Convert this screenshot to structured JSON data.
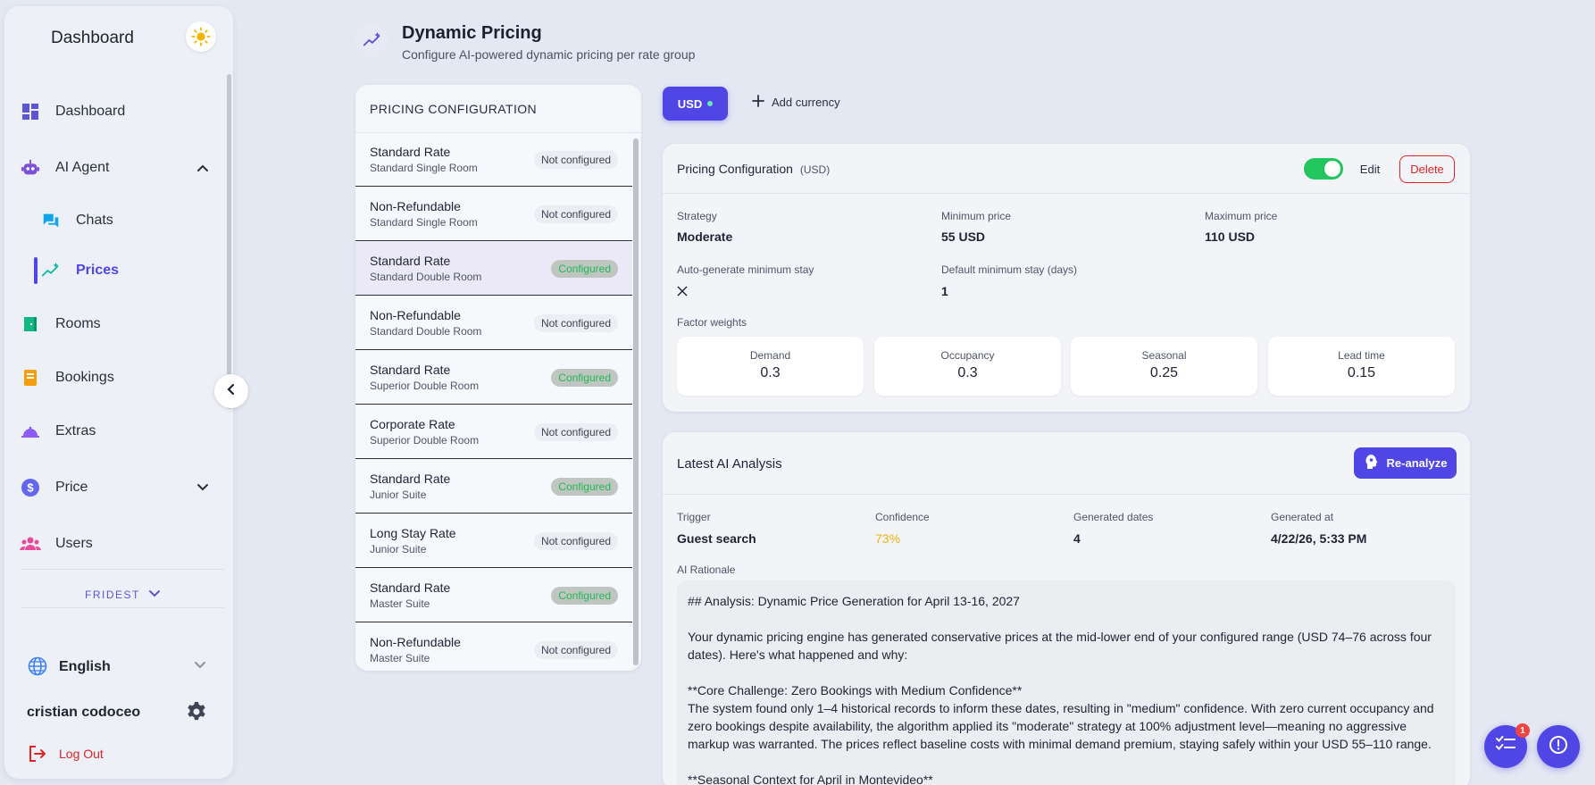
{
  "sidebar": {
    "title": "Dashboard",
    "theme_icon": "sun-icon",
    "items": [
      {
        "label": "Dashboard",
        "icon": "dashboard-grid-icon"
      },
      {
        "label": "AI Agent",
        "icon": "robot-icon"
      },
      {
        "label": "Chats",
        "icon": "chat-icon"
      },
      {
        "label": "Prices",
        "icon": "sparkle-chart-icon"
      },
      {
        "label": "Rooms",
        "icon": "door-icon"
      },
      {
        "label": "Bookings",
        "icon": "booking-icon"
      },
      {
        "label": "Extras",
        "icon": "cloche-icon"
      },
      {
        "label": "Price",
        "icon": "dollar-icon"
      },
      {
        "label": "Users",
        "icon": "users-icon"
      }
    ],
    "org": "FRIDEST",
    "language": "English",
    "user_name": "cristian codoceo",
    "logout": "Log Out"
  },
  "header": {
    "title": "Dynamic Pricing",
    "subtitle": "Configure AI-powered dynamic pricing per rate group"
  },
  "config_list": {
    "heading": "PRICING CONFIGURATION",
    "items": [
      {
        "name": "Standard Rate",
        "room": "Standard Single Room",
        "status": "Not configured"
      },
      {
        "name": "Non-Refundable",
        "room": "Standard Single Room",
        "status": "Not configured"
      },
      {
        "name": "Standard Rate",
        "room": "Standard Double Room",
        "status": "Configured"
      },
      {
        "name": "Non-Refundable",
        "room": "Standard Double Room",
        "status": "Not configured"
      },
      {
        "name": "Standard Rate",
        "room": "Superior Double Room",
        "status": "Configured"
      },
      {
        "name": "Corporate Rate",
        "room": "Superior Double Room",
        "status": "Not configured"
      },
      {
        "name": "Standard Rate",
        "room": "Junior Suite",
        "status": "Configured"
      },
      {
        "name": "Long Stay Rate",
        "room": "Junior Suite",
        "status": "Not configured"
      },
      {
        "name": "Standard Rate",
        "room": "Master Suite",
        "status": "Configured"
      },
      {
        "name": "Non-Refundable",
        "room": "Master Suite",
        "status": "Not configured"
      }
    ]
  },
  "currency": {
    "active": "USD",
    "add_label": "Add currency"
  },
  "pricing_card": {
    "title": "Pricing Configuration",
    "currency_tag": "(USD)",
    "enabled": true,
    "edit_label": "Edit",
    "delete_label": "Delete",
    "strategy_label": "Strategy",
    "strategy": "Moderate",
    "min_label": "Minimum price",
    "min": "55 USD",
    "max_label": "Maximum price",
    "max": "110 USD",
    "auto_label": "Auto-generate minimum stay",
    "auto_value_icon": "x-icon",
    "default_stay_label": "Default minimum stay (days)",
    "default_stay": "1",
    "weights_label": "Factor weights",
    "weights": [
      {
        "label": "Demand",
        "value": "0.3"
      },
      {
        "label": "Occupancy",
        "value": "0.3"
      },
      {
        "label": "Seasonal",
        "value": "0.25"
      },
      {
        "label": "Lead time",
        "value": "0.15"
      }
    ]
  },
  "analysis": {
    "title": "Latest AI Analysis",
    "reanalyze_label": "Re-analyze",
    "trigger_label": "Trigger",
    "trigger": "Guest search",
    "confidence_label": "Confidence",
    "confidence": "73%",
    "generated_dates_label": "Generated dates",
    "generated_dates": "4",
    "generated_at_label": "Generated at",
    "generated_at": "4/22/26, 5:33 PM",
    "rationale_label": "AI Rationale",
    "rationale": "## Analysis: Dynamic Price Generation for April 13-16, 2027\n\nYour dynamic pricing engine has generated conservative prices at the mid-lower end of your configured range (USD 74–76 across four dates). Here's what happened and why:\n\n**Core Challenge: Zero Bookings with Medium Confidence**\nThe system found only 1–4 historical records to inform these dates, resulting in \"medium\" confidence. With zero current occupancy and zero bookings despite availability, the algorithm applied its \"moderate\" strategy at 100% adjustment level—meaning no aggressive markup was warranted. The prices reflect baseline costs with minimal demand premium, staying safely within your USD 55–110 range.\n\n**Seasonal Context for April in Montevideo**"
  },
  "fab": {
    "tasks_badge": "1"
  },
  "colors": {
    "accent": "#4f46e5",
    "success": "#22c55e",
    "danger": "#dc2626",
    "confidence": "#eab308"
  }
}
